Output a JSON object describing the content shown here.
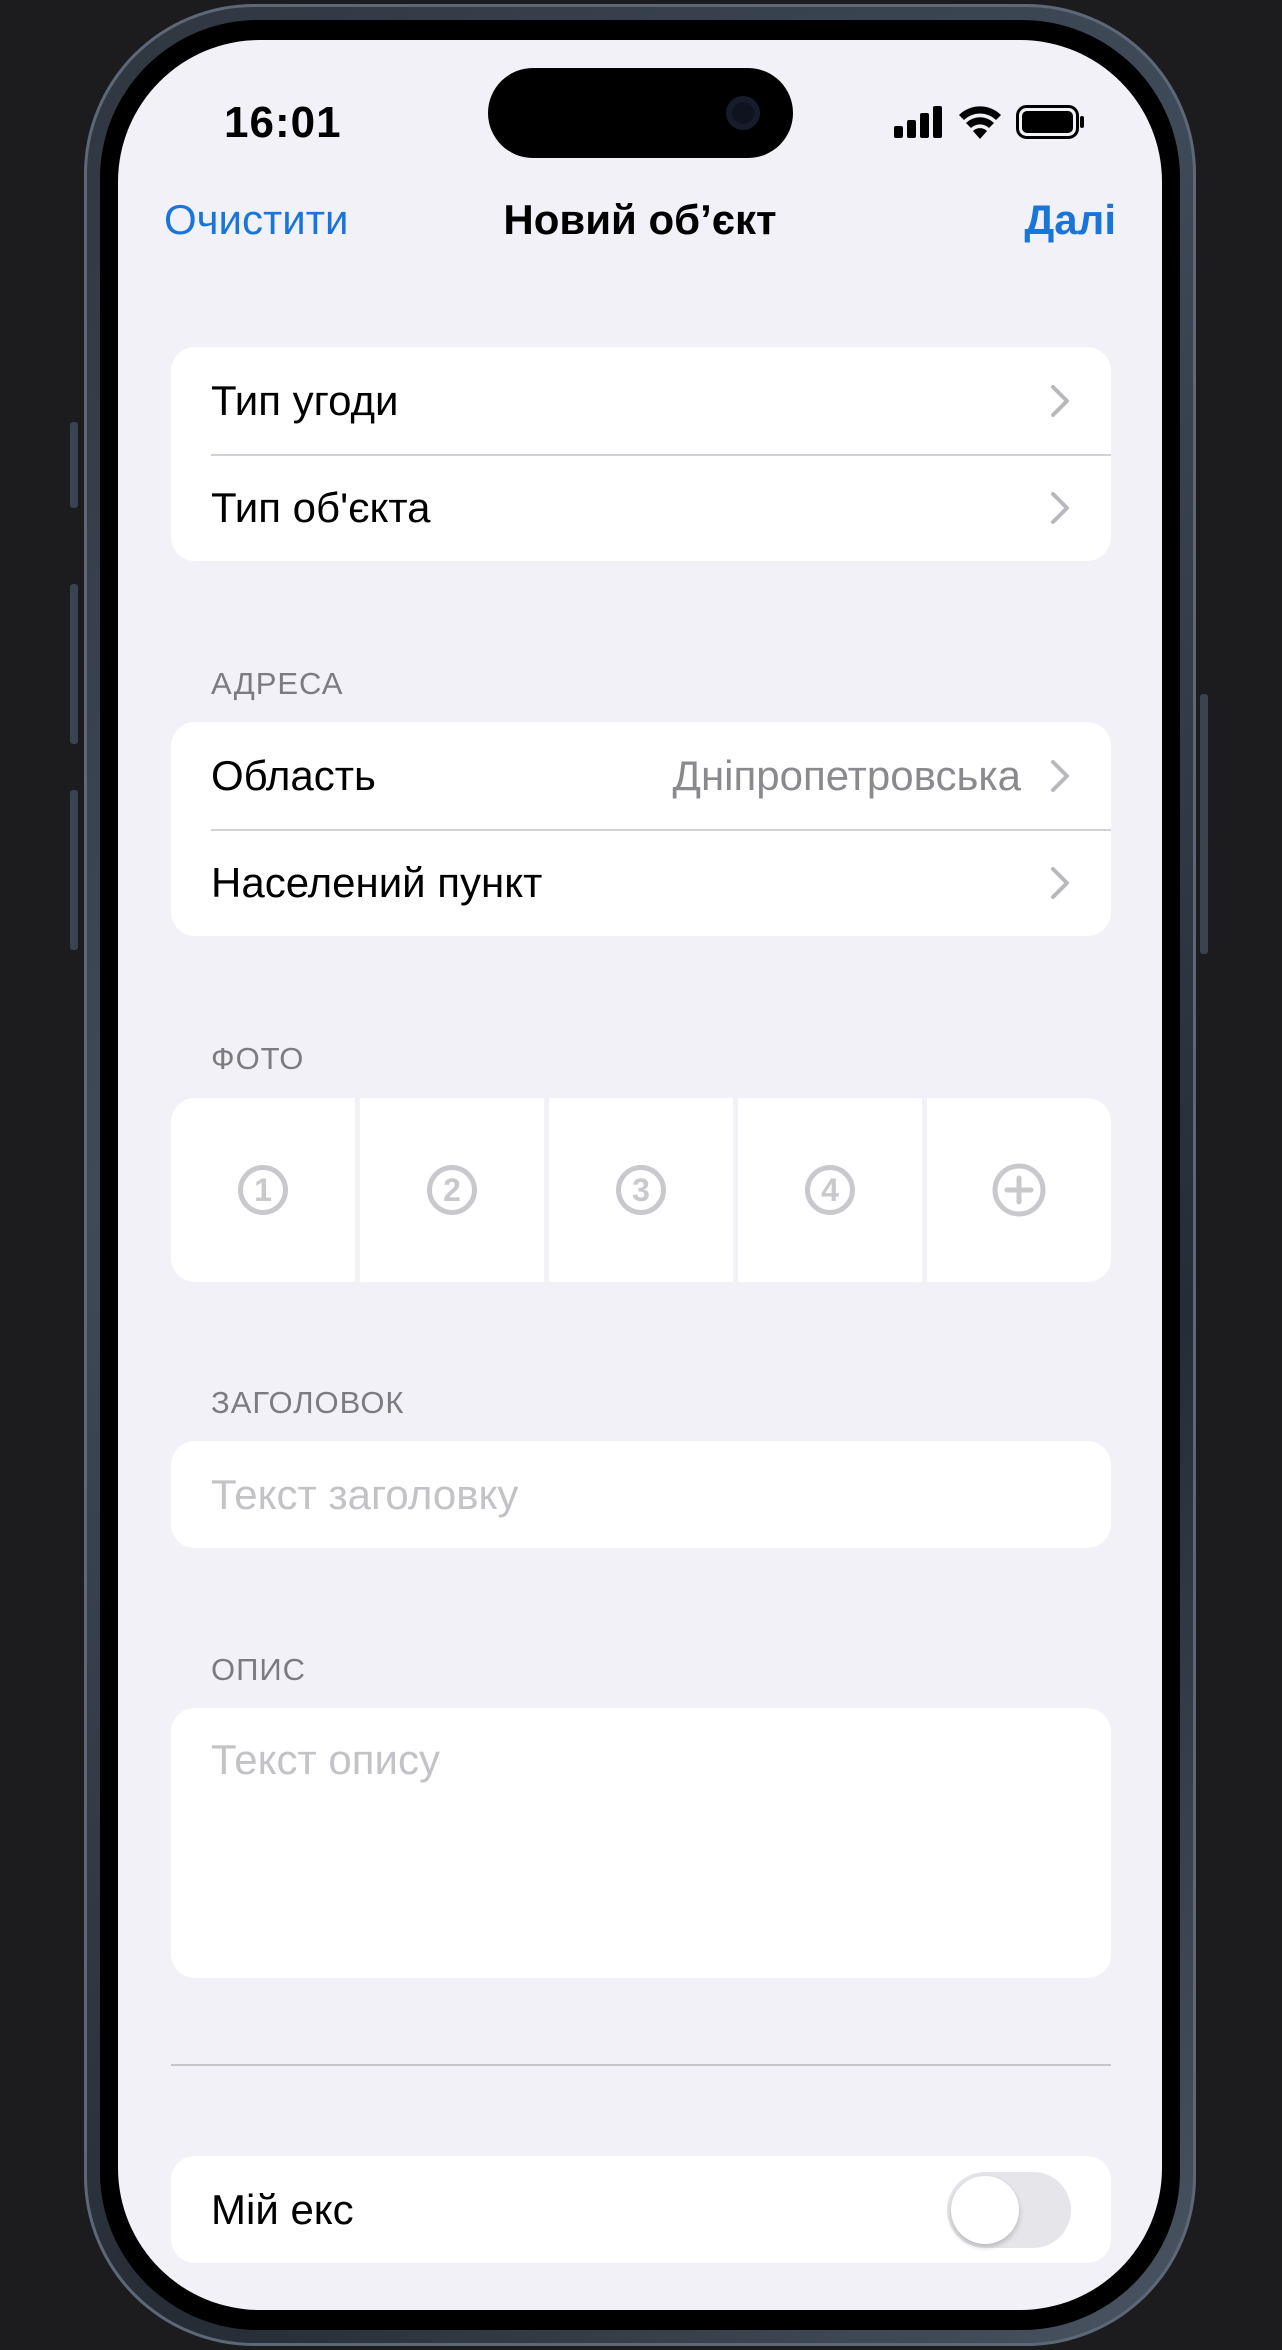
{
  "status_bar": {
    "time": "16:01"
  },
  "nav": {
    "left_label": "Очистити",
    "title": "Новий об’єкт",
    "right_label": "Далі"
  },
  "deal_group": {
    "items": [
      {
        "label": "Тип угоди"
      },
      {
        "label": "Тип об'єкта"
      }
    ]
  },
  "address": {
    "header": "АДРЕСА",
    "items": [
      {
        "label": "Область",
        "value": "Дніпропетровська"
      },
      {
        "label": "Населений пункт"
      }
    ]
  },
  "photo": {
    "header": "ФОТО",
    "slots": [
      "1",
      "2",
      "3",
      "4"
    ],
    "add_icon": "plus-circle-icon"
  },
  "title_field": {
    "header": "ЗАГОЛОВОК",
    "placeholder": "Текст заголовку"
  },
  "description_field": {
    "header": "ОПИС",
    "placeholder": "Текст опису"
  },
  "my_listing": {
    "label": "Мій екс",
    "enabled": false
  },
  "colors": {
    "accent": "#1976d8",
    "background": "#f2f1f7",
    "placeholder": "#c3c3c7"
  }
}
